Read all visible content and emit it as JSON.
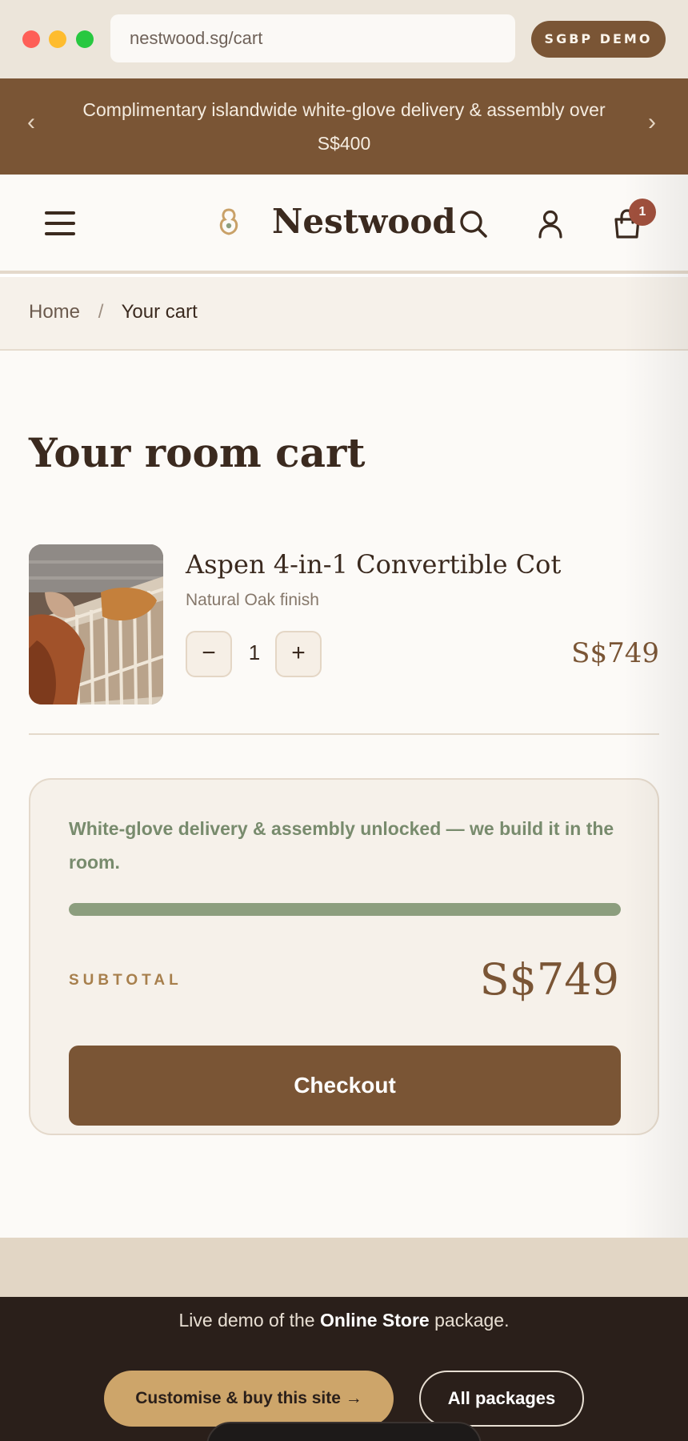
{
  "browser": {
    "url": "nestwood.sg/cart",
    "demo_label": "SGBP DEMO"
  },
  "announcement": {
    "text": "Complimentary islandwide white-glove delivery & assembly over S$400",
    "prev_glyph": "‹",
    "next_glyph": "›"
  },
  "header": {
    "brand": "Nestwood",
    "cart_count": "1",
    "icons": [
      "menu-icon",
      "brand-logo-icon",
      "search-icon",
      "account-icon",
      "cart-icon"
    ]
  },
  "breadcrumb": {
    "home": "Home",
    "separator": "/",
    "current": "Your cart"
  },
  "main": {
    "title": "Your room cart"
  },
  "cart_item": {
    "name": "Aspen 4-in-1 Convertible Cot",
    "variant": "Natural Oak finish",
    "minus_glyph": "−",
    "plus_glyph": "+",
    "quantity": "1",
    "price": "S$749"
  },
  "summary": {
    "message": "White-glove delivery & assembly unlocked — we build it in the room.",
    "progress_percent": 100,
    "subtotal_label": "SUBTOTAL",
    "subtotal_value": "S$749",
    "checkout_label": "Checkout"
  },
  "demo_footer": {
    "text_prefix": "Live demo of the ",
    "text_bold": "Online Store",
    "text_suffix": " package.",
    "buy_label": "Customise & buy this site →",
    "packages_label": "All packages"
  },
  "colors": {
    "brand_brown": "#7a5535",
    "sage": "#8c9e7e",
    "gold": "#cda56a",
    "badge": "#a0503d",
    "dark": "#2a1f1a"
  }
}
